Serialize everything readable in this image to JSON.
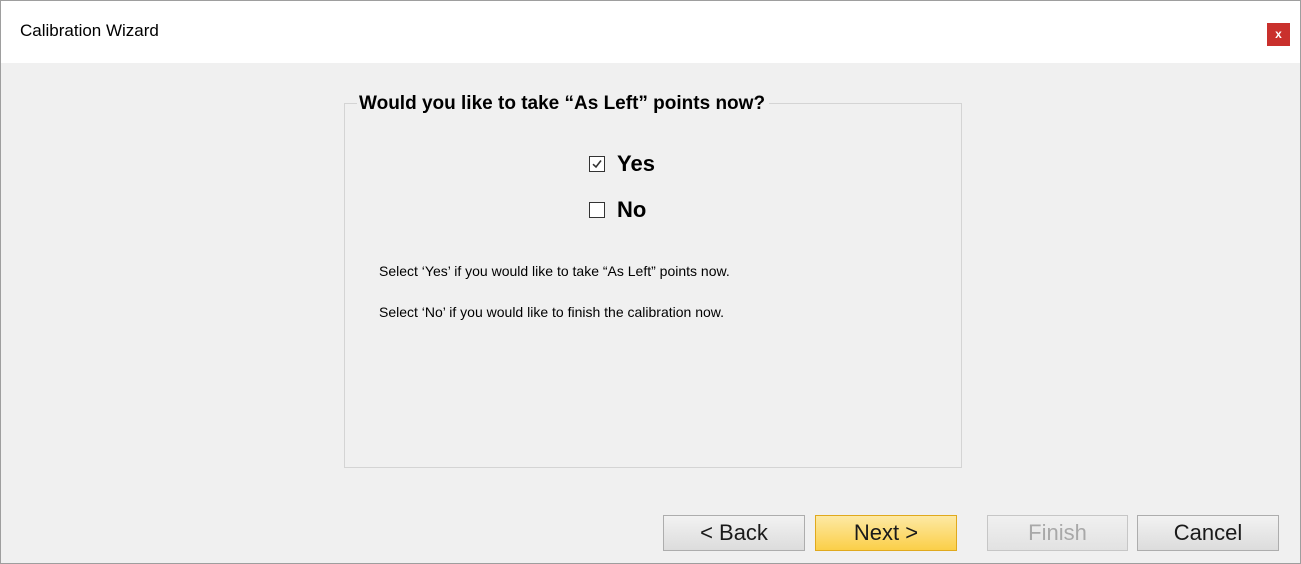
{
  "window": {
    "title": "Calibration Wizard",
    "close_label": "x"
  },
  "group": {
    "heading": "Would you like to take “As Left” points now?"
  },
  "options": {
    "yes": {
      "label": "Yes",
      "checked": true
    },
    "no": {
      "label": "No",
      "checked": false
    }
  },
  "info": {
    "line1": "Select ‘Yes’ if you would like to take “As Left” points now.",
    "line2": "Select ‘No’ if you would like to finish the calibration now."
  },
  "buttons": {
    "back": "< Back",
    "next": "Next >",
    "finish": "Finish",
    "cancel": "Cancel"
  },
  "colors": {
    "close": "#c9302c",
    "next_button": "#fbcf48",
    "disabled_text": "#a8a8a8"
  }
}
